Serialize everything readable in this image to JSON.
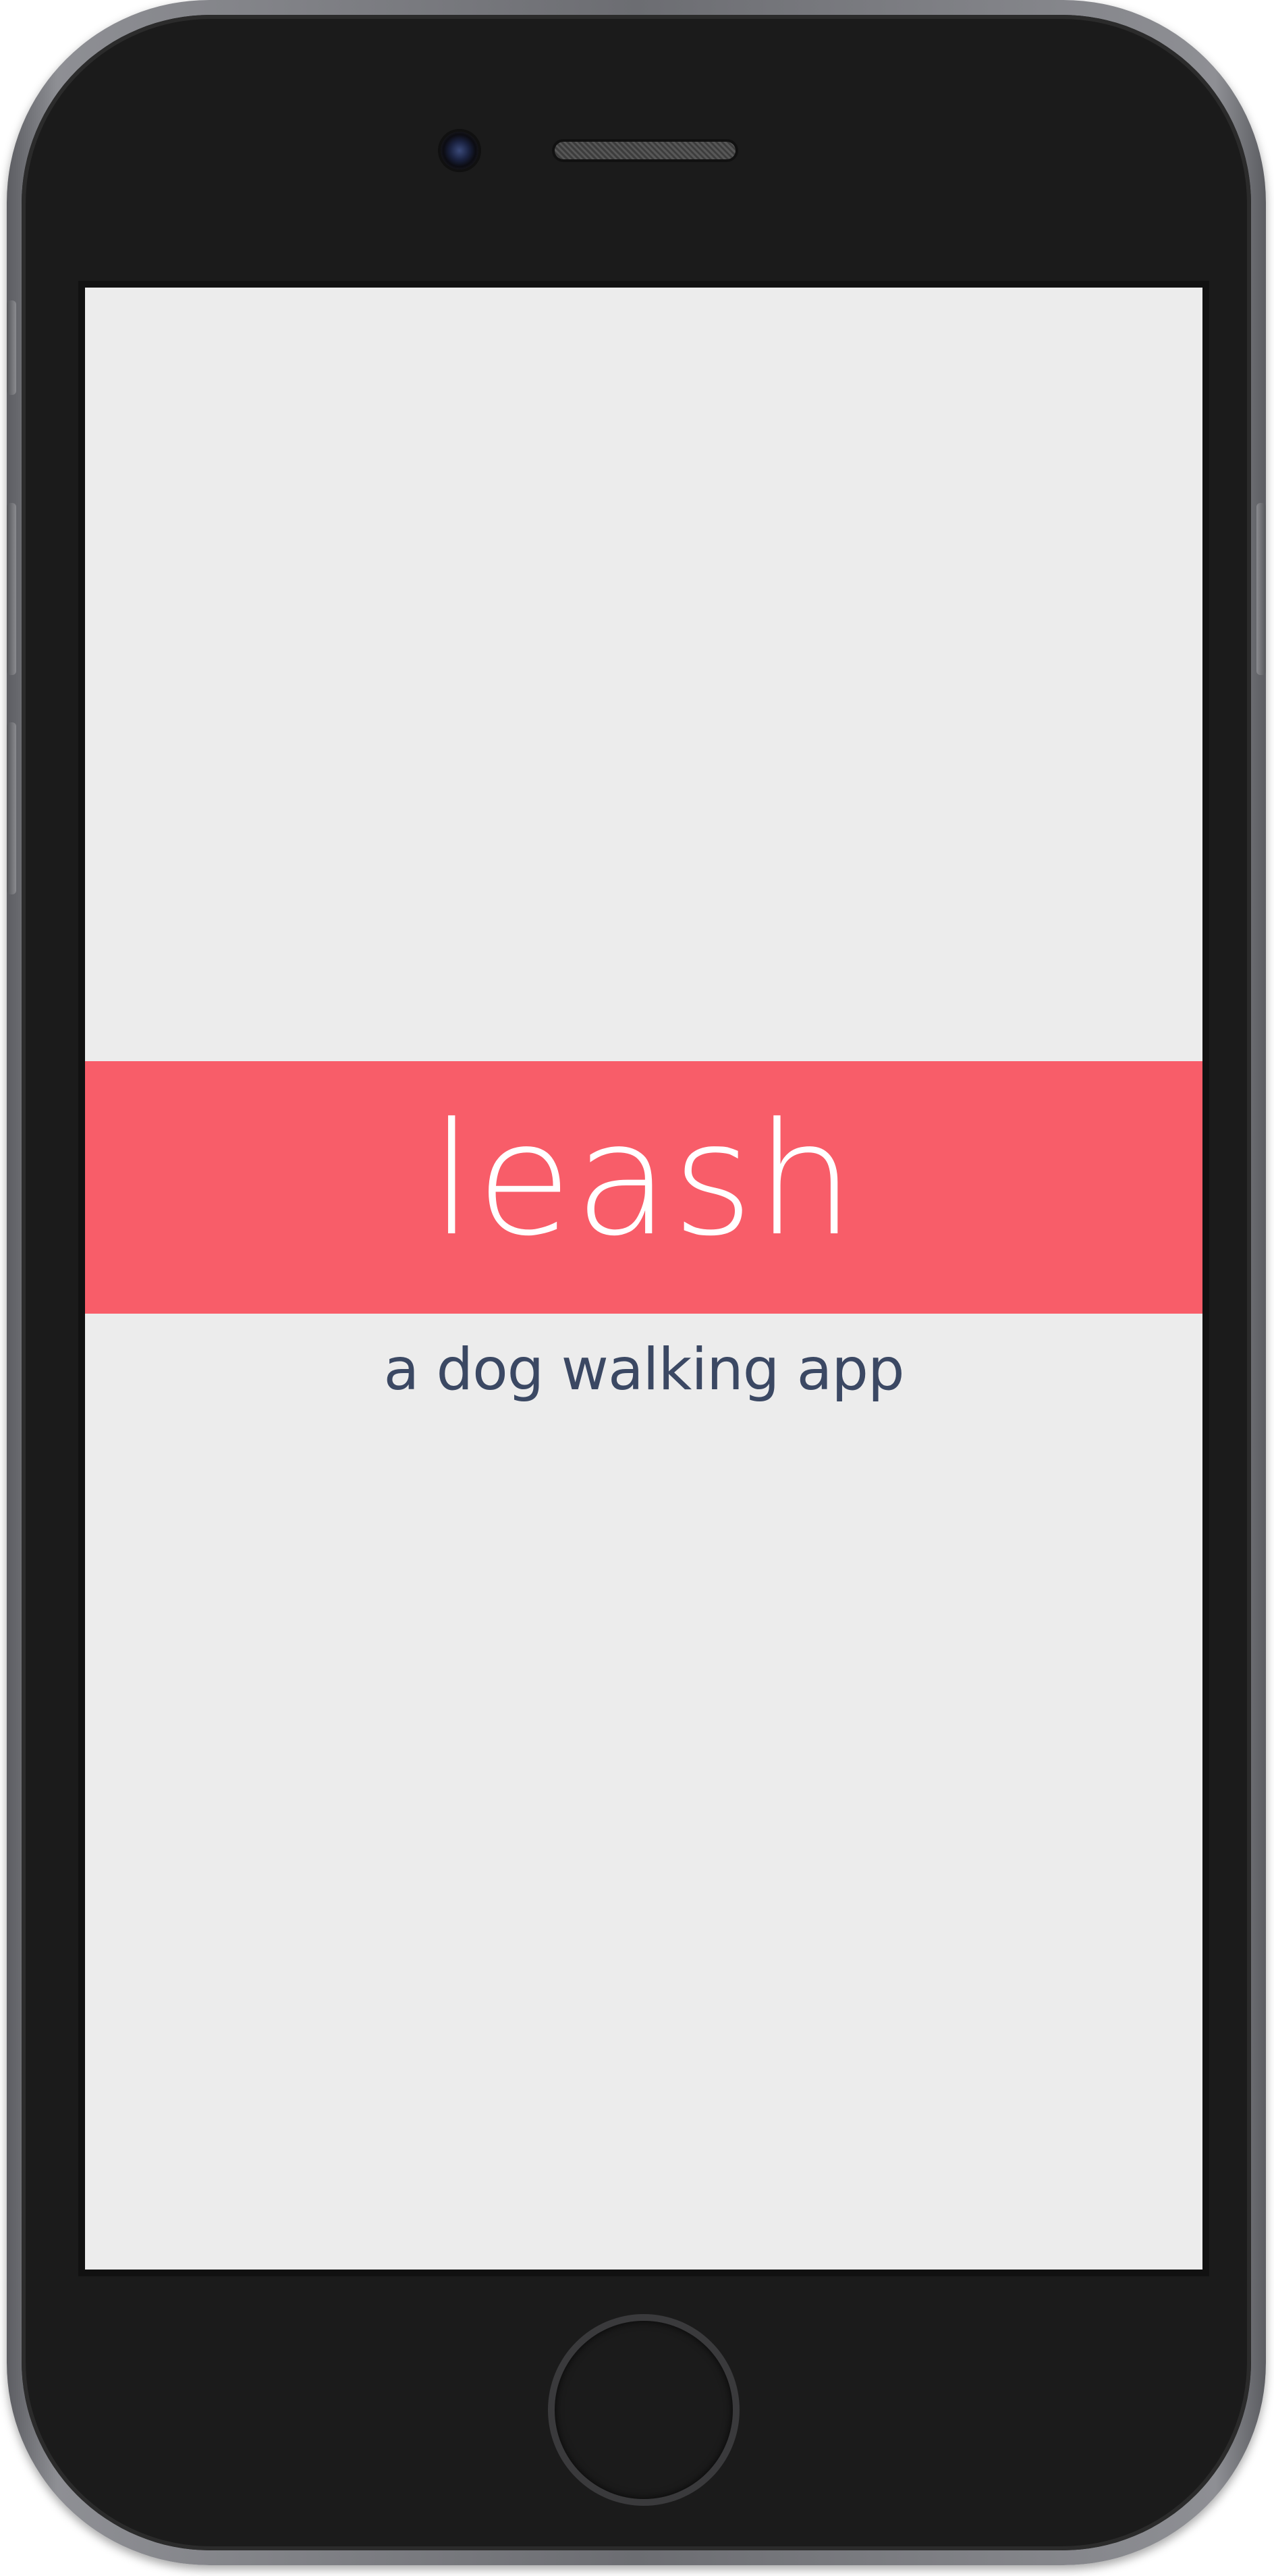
{
  "app": {
    "logo_text": "leash",
    "tagline": "a dog walking app"
  },
  "colors": {
    "banner": "#f85d69",
    "screen_background": "#ececec",
    "tagline_text": "#3b4863",
    "logo_text": "#ffffff"
  },
  "icons": {
    "camera": "front-camera-icon",
    "speaker": "speaker-grille-icon",
    "home": "home-button-icon"
  }
}
